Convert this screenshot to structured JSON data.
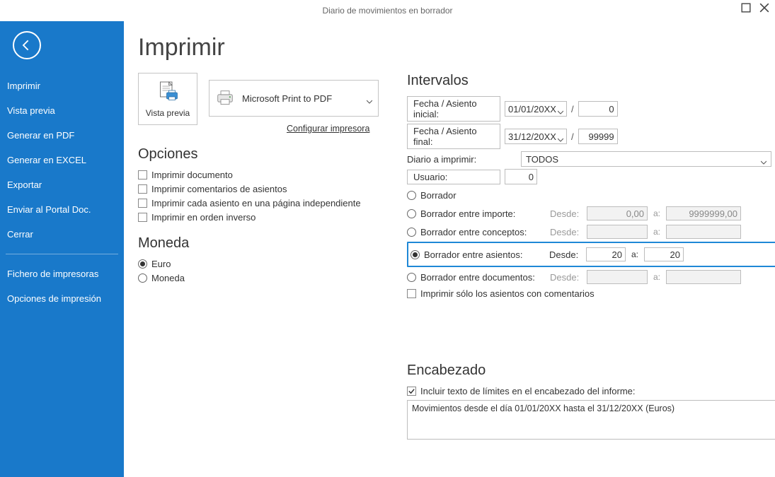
{
  "window": {
    "title": "Diario de movimientos en borrador"
  },
  "sidebar": {
    "items": [
      "Imprimir",
      "Vista previa",
      "Generar en PDF",
      "Generar en EXCEL",
      "Exportar",
      "Enviar al Portal Doc.",
      "Cerrar"
    ],
    "items2": [
      "Fichero de impresoras",
      "Opciones de impresión"
    ]
  },
  "page": {
    "title": "Imprimir",
    "vista_previa": "Vista previa",
    "printer": "Microsoft Print to PDF",
    "config_link": "Configurar impresora"
  },
  "opciones": {
    "title": "Opciones",
    "items": [
      "Imprimir documento",
      "Imprimir comentarios de asientos",
      "Imprimir cada asiento en una página independiente",
      "Imprimir en orden inverso"
    ]
  },
  "moneda": {
    "title": "Moneda",
    "euro": "Euro",
    "moneda": "Moneda"
  },
  "intervalos": {
    "title": "Intervalos",
    "fecha_inicial_label": "Fecha / Asiento inicial:",
    "fecha_inicial": "01/01/20XX",
    "asiento_inicial": "0",
    "fecha_final_label": "Fecha / Asiento final:",
    "fecha_final": "31/12/20XX",
    "asiento_final": "99999",
    "diario_label": "Diario a imprimir:",
    "diario_value": "TODOS",
    "usuario_label": "Usuario:",
    "usuario_value": "0",
    "radios": {
      "borrador": "Borrador",
      "importe": "Borrador entre importe:",
      "conceptos": "Borrador entre conceptos:",
      "asientos": "Borrador entre asientos:",
      "documentos": "Borrador entre documentos:"
    },
    "desde": "Desde:",
    "a": "a:",
    "importe_desde": "0,00",
    "importe_a": "9999999,00",
    "conceptos_desde": "",
    "conceptos_a": "",
    "asientos_desde": "20",
    "asientos_a": "20",
    "documentos_desde": "",
    "documentos_a": "",
    "solo_comentarios": "Imprimir sólo los asientos con comentarios"
  },
  "encabezado": {
    "title": "Encabezado",
    "checkbox": "Incluir texto de límites en el encabezado del informe:",
    "text": "Movimientos desde el día 01/01/20XX hasta el 31/12/20XX (Euros)"
  }
}
